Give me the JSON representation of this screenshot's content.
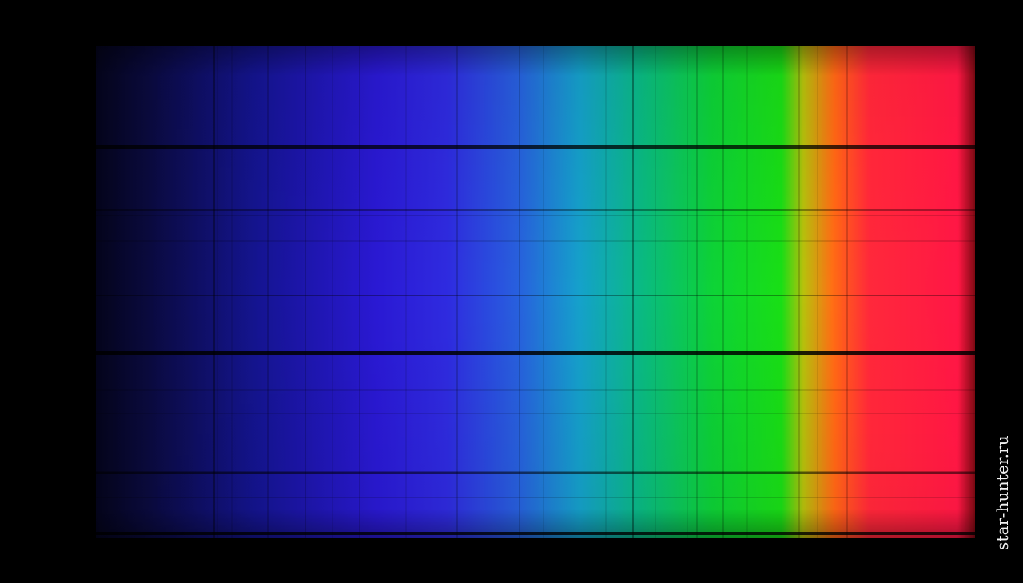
{
  "image": {
    "watermark": "star-hunter.ru",
    "colors": {
      "background": "#000000",
      "violet": "#14148a",
      "blue": "#2f2cd8",
      "cyan": "#1aa0c8",
      "green": "#20dc1c",
      "orange": "#ff6a1a",
      "red": "#ff1a46",
      "watermark_text": "#f2f2f2"
    }
  }
}
